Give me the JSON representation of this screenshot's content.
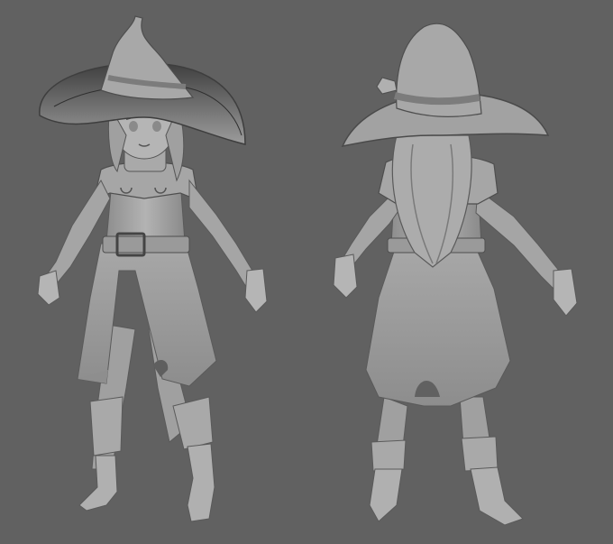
{
  "scene": {
    "background": "#616161",
    "model_fill": "#a3a3a3",
    "model_light": "#bcbcbc",
    "model_shadow": "#6f6f6f",
    "line": "#4a4a4a",
    "views": [
      {
        "name": "front-view"
      },
      {
        "name": "back-view"
      }
    ]
  }
}
